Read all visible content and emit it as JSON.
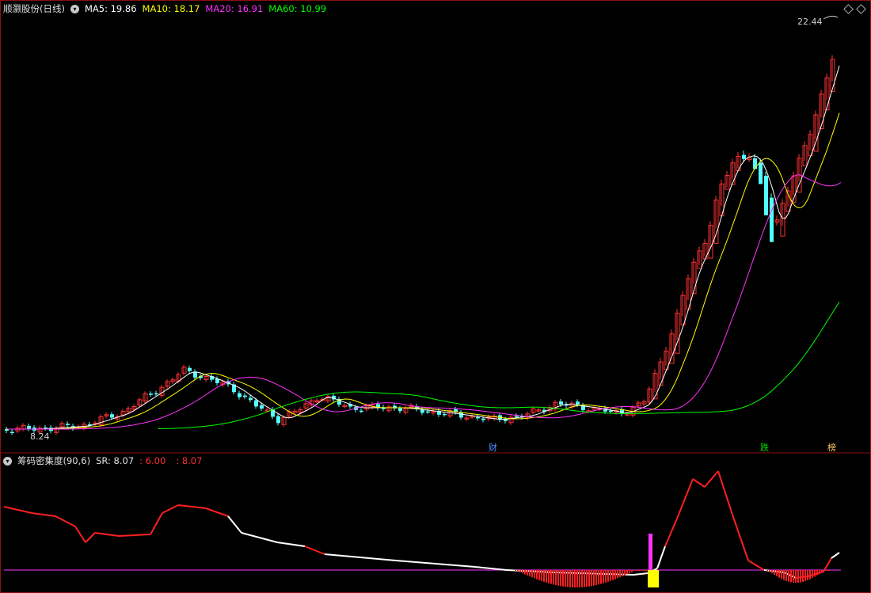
{
  "main_panel": {
    "title": "顺灏股份(日线)",
    "indicators": [
      {
        "label": "MA5: 19.86",
        "color": "#ffffff"
      },
      {
        "label": "MA10: 18.17",
        "color": "#ffff00"
      },
      {
        "label": "MA20: 16.91",
        "color": "#ff33ff"
      },
      {
        "label": "MA60: 10.99",
        "color": "#00ff00"
      }
    ],
    "max_price_label": "22.44",
    "min_price_label": "8.24",
    "markers": [
      {
        "text": "财",
        "color": "#4e8cff"
      },
      {
        "text": "跌",
        "color": "#00e000"
      },
      {
        "text": "榜",
        "color": "#ffcc66"
      }
    ]
  },
  "sub_panel": {
    "title": "筹码密集度(90,6)",
    "sr_label": "SR: 8.07",
    "v1_label": ": 6.00",
    "v2_label": ": 8.07"
  },
  "colors": {
    "up": "#ff3232",
    "down": "#54ffff",
    "ma5": "#ffffff",
    "ma10": "#ffff00",
    "ma20": "#ff33ff",
    "ma60": "#00ff00",
    "border": "#8a1111"
  },
  "chart_data": {
    "type": "candlestick",
    "series": [
      {
        "name": "MA5",
        "value": 19.86
      },
      {
        "name": "MA10",
        "value": 18.17
      },
      {
        "name": "MA20",
        "value": 16.91
      },
      {
        "name": "MA60",
        "value": 10.99
      }
    ],
    "price_range": [
      8.24,
      22.44
    ]
  }
}
